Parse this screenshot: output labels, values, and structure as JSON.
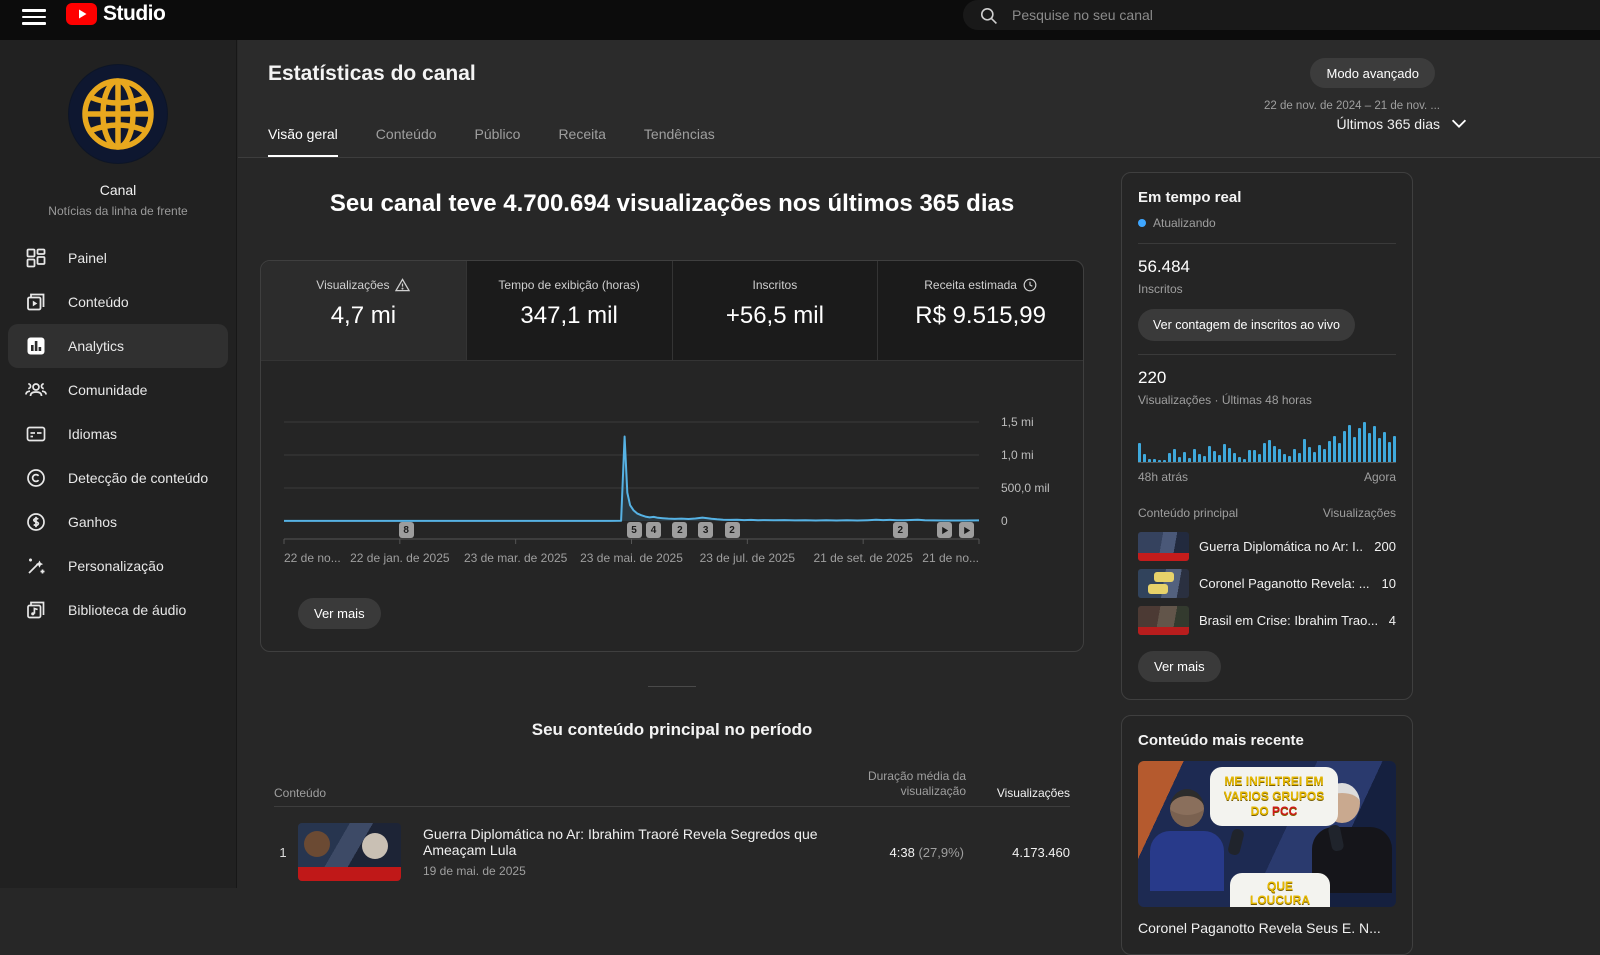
{
  "topbar": {
    "brand": "Studio",
    "search_placeholder": "Pesquise no seu canal"
  },
  "sidebar": {
    "channel": {
      "name": "Canal",
      "subtitle": "Notícias da linha de frente",
      "avatar_icon": "globe-icon"
    },
    "items": [
      {
        "icon": "dashboard-icon",
        "label": "Painel",
        "active": false
      },
      {
        "icon": "content-icon",
        "label": "Conteúdo",
        "active": false
      },
      {
        "icon": "analytics-icon",
        "label": "Analytics",
        "active": true
      },
      {
        "icon": "community-icon",
        "label": "Comunidade",
        "active": false
      },
      {
        "icon": "subtitles-icon",
        "label": "Idiomas",
        "active": false
      },
      {
        "icon": "copyright-icon",
        "label": "Detecção de conteúdo",
        "active": false
      },
      {
        "icon": "dollar-icon",
        "label": "Ganhos",
        "active": false
      },
      {
        "icon": "wand-icon",
        "label": "Personalização",
        "active": false
      },
      {
        "icon": "audio-library-icon",
        "label": "Biblioteca de áudio",
        "active": false
      }
    ]
  },
  "header": {
    "title": "Estatísticas do canal",
    "tabs": [
      {
        "label": "Visão geral",
        "active": true
      },
      {
        "label": "Conteúdo",
        "active": false
      },
      {
        "label": "Público",
        "active": false
      },
      {
        "label": "Receita",
        "active": false
      },
      {
        "label": "Tendências",
        "active": false
      }
    ],
    "advanced_mode": "Modo avançado",
    "date_range_line1": "22 de nov. de 2024 – 21 de nov. ...",
    "date_range_line2": "Últimos 365 dias"
  },
  "overview": {
    "headline": "Seu canal teve 4.700.694 visualizações nos últimos 365 dias",
    "metrics": [
      {
        "label": "Visualizações",
        "icon": "warning-icon",
        "value": "4,7 mi",
        "selected": true
      },
      {
        "label": "Tempo de exibição (horas)",
        "icon": "",
        "value": "347,1 mil",
        "selected": false
      },
      {
        "label": "Inscritos",
        "icon": "",
        "value": "+56,5 mil",
        "selected": false
      },
      {
        "label": "Receita estimada",
        "icon": "clock-icon",
        "value": "R$ 9.515,99",
        "selected": false
      }
    ],
    "timeline_markers": [
      {
        "label": "8",
        "x_pct": 17.5
      },
      {
        "label": "5",
        "x_pct": 50.3
      },
      {
        "label": "4",
        "x_pct": 53.1
      },
      {
        "label": "2",
        "x_pct": 56.9
      },
      {
        "label": "3",
        "x_pct": 60.6
      },
      {
        "label": "2",
        "x_pct": 64.4
      },
      {
        "label": "2",
        "x_pct": 88.6
      }
    ],
    "see_more": "Ver mais"
  },
  "chart_data": [
    {
      "type": "line",
      "title": "Visualizações nos últimos 365 dias",
      "x_labels": [
        "22 de no...",
        "22 de jan. de 2025",
        "23 de mar. de 2025",
        "23 de mai. de 2025",
        "23 de jul. de 2025",
        "21 de set. de 2025",
        "21 de no..."
      ],
      "y_ticks": [
        "1,5 mi",
        "1,0 mi",
        "500,0 mil",
        "0"
      ],
      "ylim_thousands": [
        0,
        1500
      ],
      "unit": "views (thousands)",
      "points": [
        [
          0,
          2
        ],
        [
          4,
          2
        ],
        [
          8,
          2
        ],
        [
          12,
          2
        ],
        [
          16,
          2
        ],
        [
          20,
          2
        ],
        [
          24,
          2
        ],
        [
          28,
          2
        ],
        [
          32,
          2
        ],
        [
          36,
          2
        ],
        [
          40,
          2
        ],
        [
          44,
          2
        ],
        [
          47,
          2
        ],
        [
          48.5,
          4
        ],
        [
          49,
          1280
        ],
        [
          49.4,
          430
        ],
        [
          49.8,
          240
        ],
        [
          50.3,
          160
        ],
        [
          50.8,
          115
        ],
        [
          51.4,
          88
        ],
        [
          52,
          66
        ],
        [
          52.6,
          55
        ],
        [
          53.2,
          62
        ],
        [
          53.8,
          48
        ],
        [
          54.5,
          42
        ],
        [
          55.3,
          36
        ],
        [
          56.2,
          32
        ],
        [
          57.2,
          36
        ],
        [
          58.2,
          30
        ],
        [
          59.2,
          38
        ],
        [
          60.2,
          52
        ],
        [
          60.8,
          44
        ],
        [
          61.5,
          34
        ],
        [
          62.3,
          26
        ],
        [
          63.2,
          20
        ],
        [
          64.2,
          16
        ],
        [
          65.2,
          20
        ],
        [
          66.2,
          13
        ],
        [
          67.2,
          16
        ],
        [
          68.2,
          11
        ],
        [
          69.2,
          14
        ],
        [
          70.5,
          11
        ],
        [
          72,
          14
        ],
        [
          73.5,
          9
        ],
        [
          75,
          12
        ],
        [
          76.5,
          8
        ],
        [
          78,
          11
        ],
        [
          79.5,
          8
        ],
        [
          81,
          10
        ],
        [
          82.5,
          8
        ],
        [
          84,
          12
        ],
        [
          85.2,
          18
        ],
        [
          86.2,
          13
        ],
        [
          87.2,
          16
        ],
        [
          88.2,
          12
        ],
        [
          89.2,
          10
        ],
        [
          90.2,
          15
        ],
        [
          91.2,
          19
        ],
        [
          92.2,
          12
        ],
        [
          93.5,
          9
        ],
        [
          95,
          8
        ],
        [
          96.5,
          8
        ],
        [
          98,
          8
        ],
        [
          100,
          9
        ]
      ],
      "peak_note": "spike ~1,28 mi em mai. 2025"
    },
    {
      "type": "bar",
      "title": "Visualizações · Últimas 48 horas",
      "xlabel_left": "48h atrás",
      "xlabel_right": "Agora",
      "total": 220,
      "values_pct": [
        45,
        18,
        8,
        6,
        4,
        3,
        22,
        30,
        12,
        25,
        10,
        32,
        20,
        14,
        38,
        26,
        16,
        44,
        34,
        22,
        12,
        6,
        28,
        28,
        18,
        45,
        52,
        38,
        30,
        20,
        14,
        30,
        22,
        55,
        35,
        25,
        40,
        30,
        50,
        62,
        45,
        75,
        88,
        60,
        80,
        95,
        70,
        85,
        58,
        72,
        48,
        62
      ]
    }
  ],
  "top_content": {
    "title": "Seu conteúdo principal no período",
    "columns": {
      "content": "Conteúdo",
      "avg_duration": "Duração média da visualização",
      "views": "Visualizações"
    },
    "rows": [
      {
        "rank": "1",
        "title": "Guerra Diplomática no Ar: Ibrahim Traoré Revela Segredos que Ameaçam Lula",
        "date": "19 de mai. de 2025",
        "avg_duration": "4:38",
        "avg_pct": "(27,9%)",
        "views": "4.173.460"
      }
    ]
  },
  "realtime": {
    "title": "Em tempo real",
    "status": "Atualizando",
    "subscribers": "56.484",
    "subscribers_label": "Inscritos",
    "live_count_button": "Ver contagem de inscritos ao vivo",
    "views_48h": "220",
    "views_48h_label": "Visualizações · Últimas 48 horas",
    "axis_left": "48h atrás",
    "axis_right": "Agora",
    "list_header_left": "Conteúdo principal",
    "list_header_right": "Visualizações",
    "top_content": [
      {
        "title": "Guerra Diplomática no Ar: I...",
        "views": "200"
      },
      {
        "title": "Coronel Paganotto Revela: ...",
        "views": "10"
      },
      {
        "title": "Brasil em Crise: Ibrahim Trao...",
        "views": "4"
      }
    ],
    "see_more": "Ver mais"
  },
  "recent": {
    "title": "Conteúdo mais recente",
    "bubble1_pre": "ME INFILTREI EM VARIOS GRUPOS DO ",
    "bubble1_red": "PCC",
    "bubble2": "QUE LOUCURA",
    "caption_partial": "Coronel Paganotto Revela Seus E. N..."
  }
}
